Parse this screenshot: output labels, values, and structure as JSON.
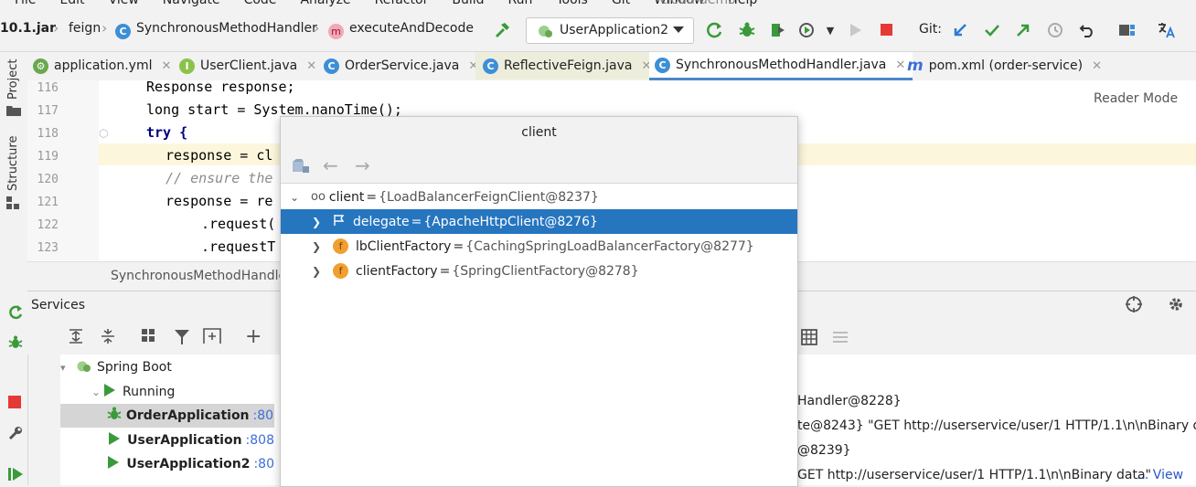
{
  "menubar": {
    "items": [
      "File",
      "Edit",
      "View",
      "Navigate",
      "Code",
      "Analyze",
      "Refactor",
      "Build",
      "Run",
      "Tools",
      "Git",
      "Window",
      "Help"
    ],
    "project_title": "cloud-demo"
  },
  "navbar": {
    "crumbs": [
      "10.1.jar",
      "feign",
      "SynchronousMethodHandler",
      "executeAndDecode"
    ],
    "run_config": "UserApplication2",
    "git_label": "Git:"
  },
  "tabs": [
    {
      "label": "application.yml",
      "icon": "yaml-icon",
      "color": "#6aa84f"
    },
    {
      "label": "UserClient.java",
      "icon": "interface-icon",
      "color": "#8bc34a"
    },
    {
      "label": "OrderService.java",
      "icon": "class-icon",
      "color": "#3d8fd6"
    },
    {
      "label": "ReflectiveFeign.java",
      "icon": "class-icon",
      "color": "#3d8fd6"
    },
    {
      "label": "SynchronousMethodHandler.java",
      "icon": "class-icon",
      "color": "#3d8fd6"
    },
    {
      "label": "pom.xml (order-service)",
      "icon": "maven-icon",
      "color": "#3d6fd6"
    }
  ],
  "left_stripe": {
    "project": "Project",
    "structure": "Structure"
  },
  "editor": {
    "reader_mode": "Reader Mode",
    "lines": [
      {
        "num": "116",
        "text": "Response response;"
      },
      {
        "num": "117",
        "text": "long start = System.nanoTime();"
      },
      {
        "num": "118",
        "text": "try {"
      },
      {
        "num": "119",
        "text": "response = cl"
      },
      {
        "num": "120",
        "text": "// ensure the"
      },
      {
        "num": "121",
        "text": "response = re"
      },
      {
        "num": "122",
        "text": ".request("
      },
      {
        "num": "123",
        "text": ".requestT"
      }
    ],
    "breadcrumb": "SynchronousMethodHandler"
  },
  "services": {
    "title": "Services",
    "tree": [
      {
        "label": "Spring Boot",
        "port": ""
      },
      {
        "label": "Running",
        "port": ""
      },
      {
        "label": "OrderApplication",
        "port": ":80"
      },
      {
        "label": "UserApplication",
        "port": ":808"
      },
      {
        "label": "UserApplication2",
        "port": ":80"
      }
    ],
    "console": [
      "Handler@8228}",
      "te@8243} \"GET http://userservice/user/1 HTTP/1.1\\n\\nBinary d...",
      "@8239}",
      "GET http://userservice/user/1 HTTP/1.1\\n\\nBinary data\""
    ],
    "view_link": "... View"
  },
  "popup": {
    "title": "client",
    "rows": [
      {
        "name": "client",
        "value": "{LoadBalancerFeignClient@8237}"
      },
      {
        "name": "delegate",
        "value": "{ApacheHttpClient@8276}"
      },
      {
        "name": "lbClientFactory",
        "value": "{CachingSpringLoadBalancerFactory@8277}"
      },
      {
        "name": "clientFactory",
        "value": "{SpringClientFactory@8278}"
      }
    ]
  },
  "colors": {
    "accent": "#2675bf",
    "run_green": "#3a9a3a",
    "stop_red": "#e53935"
  }
}
